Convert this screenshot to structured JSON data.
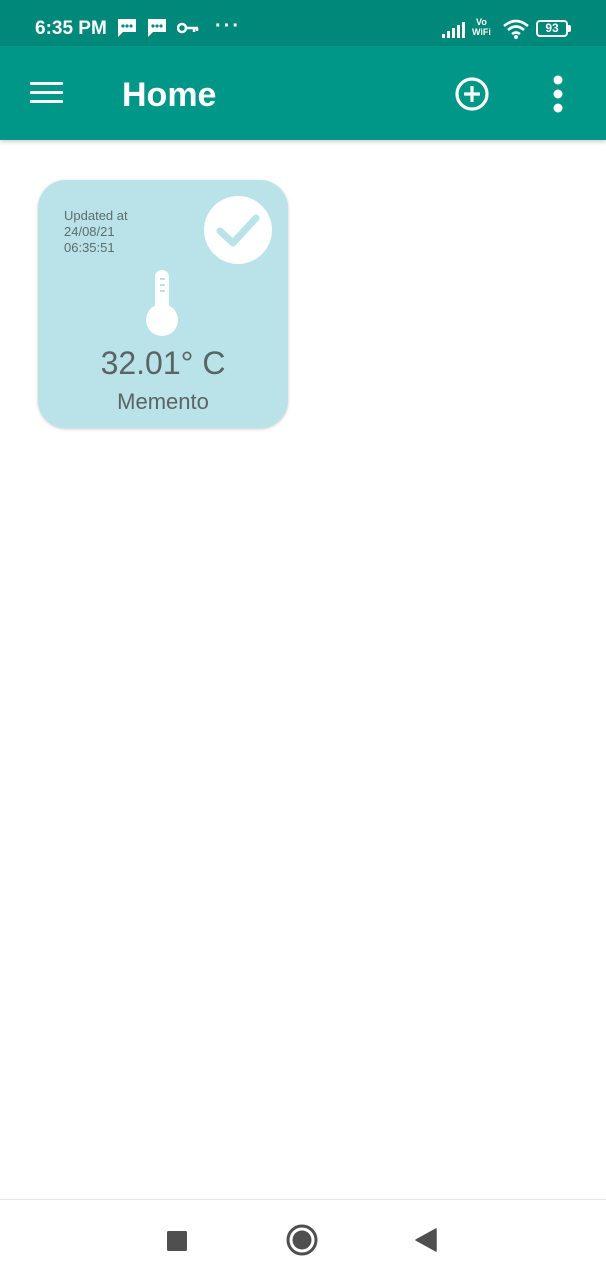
{
  "status_bar": {
    "time": "6:35 PM",
    "icons": [
      "message-icon",
      "message-icon",
      "vpn-key-icon",
      "signal-icon",
      "vowifi-icon",
      "wifi-icon",
      "battery-icon"
    ],
    "more_dots": "···",
    "vowifi_top": "Vo",
    "vowifi_bottom": "WiFi",
    "battery_level": "93"
  },
  "app_bar": {
    "title": "Home",
    "color": "#009688",
    "actions": [
      "add-icon",
      "more-vert-icon"
    ]
  },
  "device_card": {
    "updated_label": "Updated at",
    "updated_date": "24/08/21",
    "updated_time": "06:35:51",
    "temperature": "32.01° C",
    "name": "Memento",
    "status_icon": "check-circle-icon",
    "sensor_icon": "thermometer-icon",
    "background": "#b9e3e8"
  },
  "nav_bar": {
    "buttons": [
      "recents-square-icon",
      "home-circle-icon",
      "back-triangle-icon"
    ]
  }
}
